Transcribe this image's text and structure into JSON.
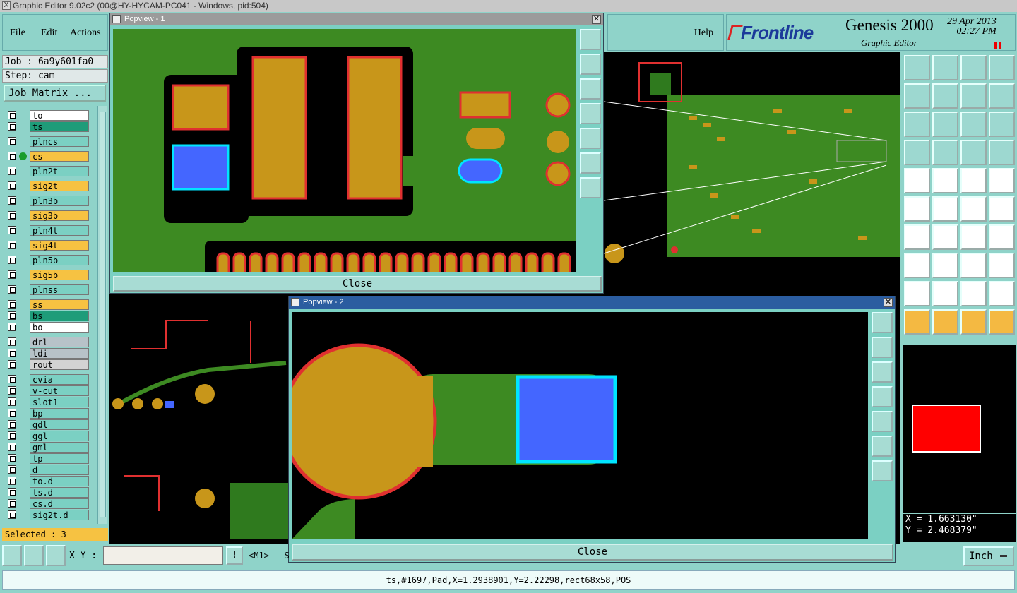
{
  "window": {
    "title": "Graphic Editor 9.02c2 (00@HY-HYCAM-PC041 - Windows, pid:504)"
  },
  "menu": {
    "file": "File",
    "edit": "Edit",
    "actions": "Actions",
    "help": "Help"
  },
  "brand": {
    "company": "Frontline",
    "product": "Genesis 2000",
    "subtitle": "Graphic Editor",
    "date": "29 Apr 2013",
    "time": "02:27 PM"
  },
  "job": {
    "job_label": "Job : 6a9y601fa0",
    "step_label": "Step: cam",
    "matrix_button": "Job Matrix ..."
  },
  "layers": [
    {
      "name": "to",
      "color": "#ffffff"
    },
    {
      "name": "ts",
      "color": "#1e9c79"
    },
    {
      "name": "plncs",
      "color": "#7bd0c3"
    },
    {
      "name": "cs",
      "color": "#f6c242"
    },
    {
      "name": "pln2t",
      "color": "#7bd0c3"
    },
    {
      "name": "sig2t",
      "color": "#f6c242"
    },
    {
      "name": "pln3b",
      "color": "#7bd0c3"
    },
    {
      "name": "sig3b",
      "color": "#f6c242"
    },
    {
      "name": "pln4t",
      "color": "#7bd0c3"
    },
    {
      "name": "sig4t",
      "color": "#f6c242"
    },
    {
      "name": "pln5b",
      "color": "#7bd0c3"
    },
    {
      "name": "sig5b",
      "color": "#f6c242"
    },
    {
      "name": "plnss",
      "color": "#7bd0c3"
    },
    {
      "name": "ss",
      "color": "#f6c242"
    },
    {
      "name": "bs",
      "color": "#1e9c79"
    },
    {
      "name": "bo",
      "color": "#ffffff"
    },
    {
      "name": "drl",
      "color": "#b7c2c8"
    },
    {
      "name": "ldi",
      "color": "#b7c2c8"
    },
    {
      "name": "rout",
      "color": "#d3d3d3"
    },
    {
      "name": "cvia",
      "color": "#7bd0c3"
    },
    {
      "name": "v-cut",
      "color": "#7bd0c3"
    },
    {
      "name": "slot1",
      "color": "#7bd0c3"
    },
    {
      "name": "bp",
      "color": "#7bd0c3"
    },
    {
      "name": "gdl",
      "color": "#7bd0c3"
    },
    {
      "name": "ggl",
      "color": "#7bd0c3"
    },
    {
      "name": "gml",
      "color": "#7bd0c3"
    },
    {
      "name": "tp",
      "color": "#7bd0c3"
    },
    {
      "name": "d",
      "color": "#7bd0c3"
    },
    {
      "name": "to.d",
      "color": "#7bd0c3"
    },
    {
      "name": "ts.d",
      "color": "#7bd0c3"
    },
    {
      "name": "cs.d",
      "color": "#7bd0c3"
    },
    {
      "name": "sig2t.d",
      "color": "#7bd0c3"
    }
  ],
  "selected": "Selected : 3",
  "popup1": {
    "title": "Popview - 1",
    "close": "Close"
  },
  "popup2": {
    "title": "Popview - 2",
    "close": "Close"
  },
  "coords": {
    "x": "X = 1.663130\"",
    "y": "Y = 2.468379\""
  },
  "xy_label": "X Y :",
  "mouse_hint": "<M1> - S",
  "units": "Inch",
  "status": "ts,#1697,Pad,X=1.2938901,Y=2.22298,rect68x58,POS",
  "tools": [
    "zoom-in-icon",
    "pan-icon",
    "home-icon",
    "split-icon",
    "zoom-out-icon",
    "move-icon",
    "undo-icon",
    "snap-icon",
    "fit-icon",
    "center-icon",
    "scale-icon",
    "help-icon",
    "measure-icon",
    "grid-icon",
    "layers-icon",
    "features-icon",
    "add-pad-icon",
    "add-line-icon",
    "ruler-icon",
    "add-surface-icon",
    "connect-icon",
    "delete-icon",
    "split-line-icon",
    "move-feature-icon",
    "angle-icon",
    "slash-icon",
    "arc-icon",
    "flip-icon",
    "copy-icon",
    "resize-icon",
    "stretch-icon",
    "attribute-icon",
    "fill-icon",
    "triangle-icon",
    "arch-icon",
    "spread-icon",
    "select-icon",
    "select-box-icon",
    "select-move-icon",
    "route-icon"
  ]
}
